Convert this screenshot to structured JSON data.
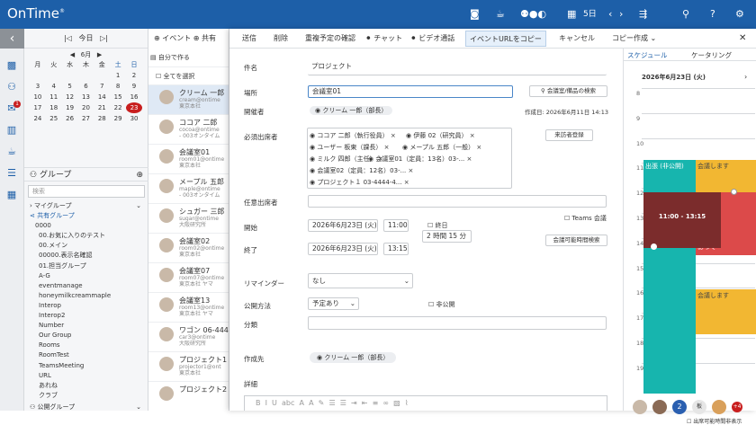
{
  "app": {
    "logo": "OnTime",
    "logo_mark": "®",
    "date_label": "5日",
    "notification_count": "1"
  },
  "left_nav": {
    "collapse": "‹"
  },
  "mini_cal": {
    "today_btn": "今日",
    "month": "6月",
    "weekdays": [
      "月",
      "火",
      "水",
      "木",
      "金",
      "土",
      "日"
    ],
    "weeks": [
      [
        "",
        "",
        "",
        "",
        "",
        "1",
        "2"
      ],
      [
        "3",
        "4",
        "5",
        "6",
        "7",
        "8",
        "9"
      ],
      [
        "10",
        "11",
        "12",
        "13",
        "14",
        "15",
        "16"
      ],
      [
        "17",
        "18",
        "19",
        "20",
        "21",
        "22",
        "23"
      ],
      [
        "24",
        "25",
        "26",
        "27",
        "28",
        "29",
        "30"
      ]
    ],
    "today": "23"
  },
  "groups": {
    "title": "グループ",
    "search_placeholder": "検索",
    "my_group": "マイグループ",
    "shared_group": "共有グループ",
    "items": [
      "0000",
      "00.お気に入りのテスト",
      "00.メイン",
      "00000.表示名確認",
      "01.担当グループ",
      "A-G",
      "eventmanage",
      "honeymilkcreammaple",
      "Interop",
      "Interop2",
      "Number",
      "Our Group",
      "Rooms",
      "RoomTest",
      "TeamsMeeting",
      "URL",
      "あれね",
      "クラブ"
    ],
    "public_group": "公開グループ"
  },
  "list": {
    "event_btn": "イベント",
    "shared_btn": "共有",
    "self_create": "自分で作る",
    "select_all": "全てを選択",
    "people": [
      {
        "name": "クリーム 一郎",
        "email": "cream@ontime",
        "sub": "東京本社"
      },
      {
        "name": "ココア 二郎",
        "email": "cocoa@ontime",
        "sub": "- 003オンタイム"
      },
      {
        "name": "会議室01",
        "email": "room01@ontime",
        "sub": "東京本社"
      },
      {
        "name": "メープル 五郎",
        "email": "maple@ontime",
        "sub": "- 003オンタイム"
      },
      {
        "name": "シュガー 三郎",
        "email": "sugar@ontime",
        "sub": "大阪研究所"
      },
      {
        "name": "会議室02",
        "email": "room02@ontime",
        "sub": "東京本社"
      },
      {
        "name": "会議室07",
        "email": "room07@ontime",
        "sub": "東京本社 ヤマ"
      },
      {
        "name": "会議室13",
        "email": "room13@ontime",
        "sub": "東京本社 ヤマ"
      },
      {
        "name": "ワゴン 06-4444",
        "email": "car3@ontime",
        "sub": "大阪研究所"
      },
      {
        "name": "プロジェクト1",
        "email": "projector1@ont",
        "sub": "東京本社"
      },
      {
        "name": "プロジェクト2",
        "email": "",
        "sub": ""
      }
    ]
  },
  "dialog": {
    "toolbar": {
      "send": "送信",
      "delete": "削除",
      "check_repeat": "重複予定の確認",
      "chat": "チャット",
      "video": "ビデオ通話",
      "copy_url": "イベントURLをコピー",
      "cancel": "キャンセル",
      "copy_create": "コピー作成",
      "close": "✕"
    },
    "labels": {
      "title": "件名",
      "place": "場所",
      "organizer": "開催者",
      "required": "必須出席者",
      "optional": "任意出席者",
      "start": "開始",
      "end": "終了",
      "reminder": "リマインダー",
      "visibility": "公開方法",
      "category": "分類",
      "creator": "作成先",
      "detail": "詳細"
    },
    "values": {
      "title": "プロジェクト",
      "place": "会議室01",
      "organizer": "クリーム 一郎（部長）",
      "created": "作成日: 2026年6月11日 14:13",
      "attendees": [
        "ココア 二郎（執行役員）",
        "伊藤 02（研究員）",
        "ユーザー 板東（課長）",
        "メープル 五郎（一般）",
        "ミルク 四郎（主任）",
        "会議室01（定員：13名）03-...",
        "会議室02（定員：12名）03-...",
        "プロジェクト１ 03-4444-4..."
      ],
      "start_date": "2026年6月23日 (火)",
      "start_time": "11:00",
      "end_date": "2026年6月23日 (火)",
      "end_time": "13:15",
      "allday": "終日",
      "duration": "2 時間 15 分",
      "teams": "Teams 会議",
      "reminder": "なし",
      "visibility": "予定あり",
      "private": "非公開",
      "creator": "クリーム 一郎（部長）"
    },
    "buttons": {
      "room_search": "会議室/備品の検索",
      "visitor": "来訪者登録",
      "available": "会議可能時間検索"
    }
  },
  "side": {
    "tab_schedule": "スケジュール",
    "tab_catering": "ケータリング",
    "date": "2026年6月23日 (火)",
    "hours": [
      "8",
      "9",
      "10",
      "11",
      "12",
      "13",
      "14",
      "15",
      "16",
      "17",
      "18",
      "19"
    ],
    "events": [
      {
        "label": "出張 (非公開)"
      },
      {
        "label": "会議します"
      },
      {
        "label": "11:00 - 13:15"
      },
      {
        "label": "あって"
      },
      {
        "label": "会議します"
      }
    ],
    "avatar_more": "+4",
    "avatar_num": "2",
    "bottom_check": "出席可能時間非表示"
  }
}
